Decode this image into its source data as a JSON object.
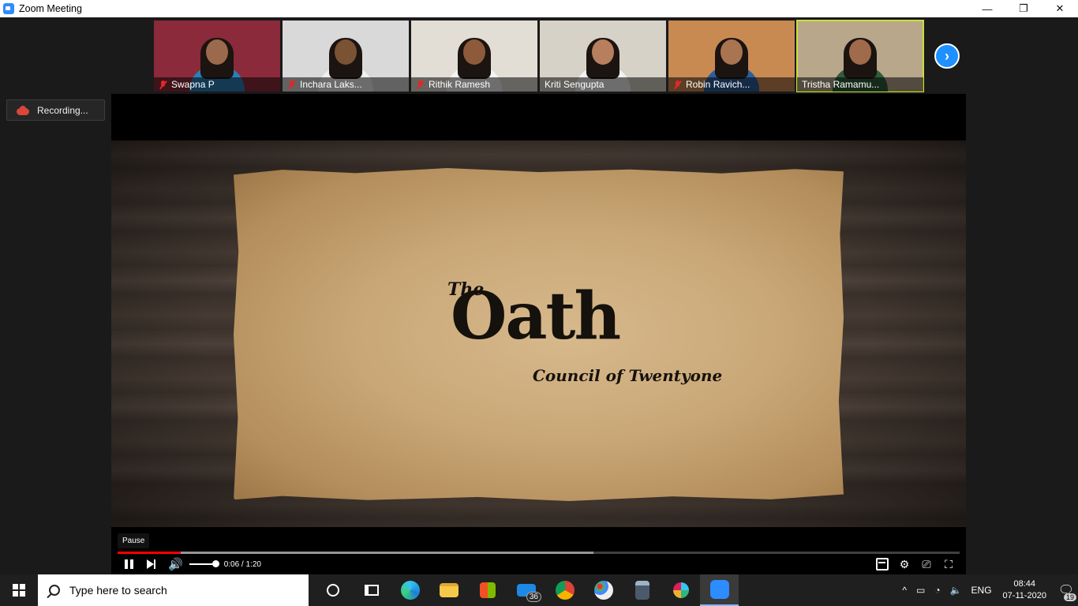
{
  "window": {
    "title": "Zoom Meeting",
    "minimize": "—",
    "restore": "❐",
    "close": "✕"
  },
  "participants": [
    {
      "name": "Swapna P",
      "muted": true,
      "bg": "#8a2a3b",
      "skin": "#9b6a4c",
      "shirt": "#2b7fb8"
    },
    {
      "name": "Inchara Laks...",
      "muted": true,
      "bg": "#d9d9d9",
      "skin": "#7a5234",
      "shirt": "#f0f0f0"
    },
    {
      "name": "Rithik Ramesh",
      "muted": true,
      "bg": "#e2ded5",
      "skin": "#8d5a3c",
      "shirt": "#f4f4f4"
    },
    {
      "name": "Kriti Sengupta",
      "muted": false,
      "bg": "#d6d2c8",
      "skin": "#b77f5e",
      "shirt": "#f2f2f2"
    },
    {
      "name": "Robin Ravich...",
      "muted": true,
      "bg": "#c98a52",
      "skin": "#a97450",
      "shirt": "#2e5d9c"
    },
    {
      "name": "Tristha Ramamu...",
      "muted": false,
      "bg": "#b9a78c",
      "skin": "#a06b4a",
      "shirt": "#2f5d3a"
    }
  ],
  "recording": {
    "label": "Recording..."
  },
  "video": {
    "title_small": "The",
    "title_main": "Oath",
    "subtitle": "Council of Twentyone",
    "tooltip": "Pause",
    "time": "0:06 / 1:20",
    "progress_played": 0.075,
    "progress_loaded": 0.565
  },
  "taskbar": {
    "search_placeholder": "Type here to search",
    "mail_badge": "36",
    "language": "ENG",
    "time": "08:44",
    "date": "07-11-2020",
    "notifications": "19"
  },
  "colors": {
    "zoom_blue": "#2d8cff",
    "active_speaker": "#c8e03a",
    "progress_red": "#ff0000"
  }
}
